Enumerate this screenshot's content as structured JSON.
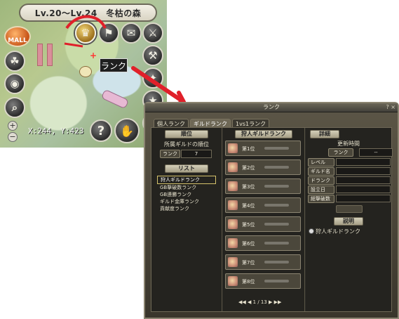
{
  "minimap": {
    "area": "Lv.20～Lv.24　冬枯の森",
    "mall": "MALL",
    "tooltip": "ランク",
    "coords": "X:244, Y:423",
    "zoom_in": "+",
    "zoom_out": "−",
    "help": "?"
  },
  "window": {
    "title": "ランク",
    "controls": "? ×",
    "tabs": [
      "個人ランク",
      "ギルドランク",
      "1vs1ランク"
    ],
    "left": {
      "rank_header": "順位",
      "own_guild_rank_label": "所属ギルドの順位",
      "rank_label": "ランク",
      "rank_value": "7",
      "list_header": "リスト",
      "list_items": [
        "狩人ギルドランク",
        "GB撃破数ランク",
        "GB連勝ランク",
        "ギルド金庫ランク",
        "貢献度ランク"
      ]
    },
    "middle": {
      "header": "狩人ギルドランク",
      "ranks": [
        "第1位",
        "第2位",
        "第3位",
        "第4位",
        "第5位",
        "第6位",
        "第7位",
        "第8位"
      ],
      "pager": "1 / 13"
    },
    "right": {
      "detail_header": "詳細",
      "update_label": "更新時間",
      "rank_label": "ランク",
      "rank_value": "--",
      "fields": [
        "レベル",
        "ギルド名",
        "ドランク",
        "設立日",
        "総撃破数"
      ],
      "desc_header": "説明",
      "desc_item": "狩人ギルドランク"
    }
  },
  "colors": {
    "accent_red": "#e0202a",
    "window_bg": "#2b2a26",
    "header_bg": "#d4cfb9"
  }
}
